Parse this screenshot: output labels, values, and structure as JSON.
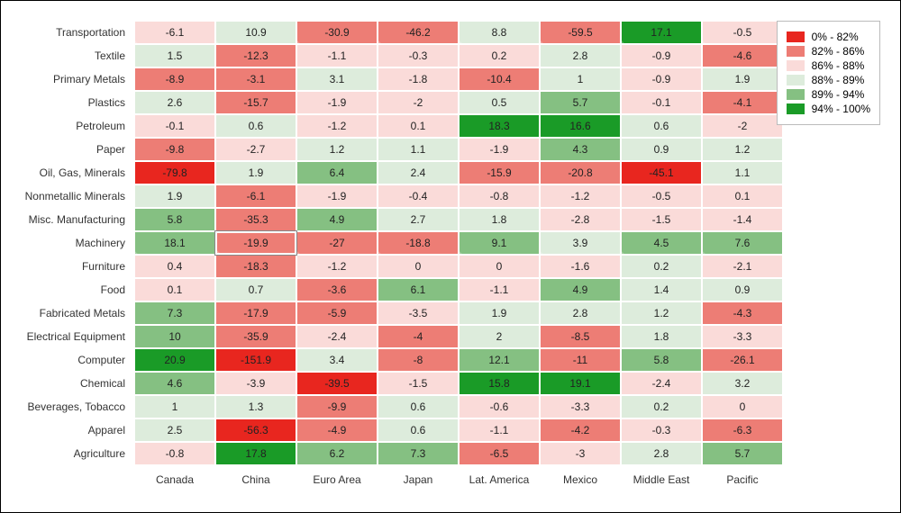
{
  "chart_data": {
    "type": "heatmap",
    "title": "",
    "xlabel": "",
    "ylabel": "",
    "x": [
      "Canada",
      "China",
      "Euro Area",
      "Japan",
      "Lat. America",
      "Mexico",
      "Middle East",
      "Pacific"
    ],
    "y": [
      "Transportation",
      "Textile",
      "Primary Metals",
      "Plastics",
      "Petroleum",
      "Paper",
      "Oil, Gas, Minerals",
      "Nonmetallic Minerals",
      "Misc. Manufacturing",
      "Machinery",
      "Furniture",
      "Food",
      "Fabricated Metals",
      "Electrical Equipment",
      "Computer",
      "Chemical",
      "Beverages, Tobacco",
      "Apparel",
      "Agriculture"
    ],
    "values": [
      [
        -6.1,
        10.9,
        -30.9,
        -46.2,
        8.8,
        -59.5,
        17.1,
        -0.5
      ],
      [
        1.5,
        -12.3,
        -1.1,
        -0.3,
        0.2,
        2.8,
        -0.9,
        -4.6
      ],
      [
        -8.9,
        -3.1,
        3.1,
        -1.8,
        -10.4,
        1,
        -0.9,
        1.9
      ],
      [
        2.6,
        -15.7,
        -1.9,
        -2,
        0.5,
        5.7,
        -0.1,
        -4.1
      ],
      [
        -0.1,
        0.6,
        -1.2,
        0.1,
        18.3,
        16.6,
        0.6,
        -2
      ],
      [
        -9.8,
        -2.7,
        1.2,
        1.1,
        -1.9,
        4.3,
        0.9,
        1.2
      ],
      [
        -79.8,
        1.9,
        6.4,
        2.4,
        -15.9,
        -20.8,
        -45.1,
        1.1
      ],
      [
        1.9,
        -6.1,
        -1.9,
        -0.4,
        -0.8,
        -1.2,
        -0.5,
        0.1
      ],
      [
        5.8,
        -35.3,
        4.9,
        2.7,
        1.8,
        -2.8,
        -1.5,
        -1.4
      ],
      [
        18.1,
        -19.9,
        -27,
        -18.8,
        9.1,
        3.9,
        4.5,
        7.6
      ],
      [
        0.4,
        -18.3,
        -1.2,
        0,
        0,
        -1.6,
        0.2,
        -2.1
      ],
      [
        0.1,
        0.7,
        -3.6,
        6.1,
        -1.1,
        4.9,
        1.4,
        0.9
      ],
      [
        7.3,
        -17.9,
        -5.9,
        -3.5,
        1.9,
        2.8,
        1.2,
        -4.3
      ],
      [
        10,
        -35.9,
        -2.4,
        -4,
        2,
        -8.5,
        1.8,
        -3.3
      ],
      [
        20.9,
        -151.9,
        3.4,
        -8,
        12.1,
        -11,
        5.8,
        -26.1
      ],
      [
        4.6,
        -3.9,
        -39.5,
        -1.5,
        15.8,
        19.1,
        -2.4,
        3.2
      ],
      [
        1,
        1.3,
        -9.9,
        0.6,
        -0.6,
        -3.3,
        0.2,
        0
      ],
      [
        2.5,
        -56.3,
        -4.9,
        0.6,
        -1.1,
        -4.2,
        -0.3,
        -6.3
      ],
      [
        -0.8,
        17.8,
        6.2,
        7.3,
        -6.5,
        -3,
        2.8,
        5.7
      ]
    ],
    "color_bins": [
      [
        2,
        3,
        1,
        1,
        3,
        1,
        5,
        2
      ],
      [
        3,
        1,
        2,
        2,
        2,
        3,
        2,
        1
      ],
      [
        1,
        1,
        3,
        2,
        1,
        3,
        2,
        3
      ],
      [
        3,
        1,
        2,
        2,
        3,
        4,
        2,
        1
      ],
      [
        2,
        3,
        2,
        2,
        5,
        5,
        3,
        2
      ],
      [
        1,
        2,
        3,
        3,
        2,
        4,
        3,
        3
      ],
      [
        0,
        3,
        4,
        3,
        1,
        1,
        0,
        3
      ],
      [
        3,
        1,
        2,
        2,
        2,
        2,
        2,
        2
      ],
      [
        4,
        1,
        4,
        3,
        3,
        2,
        2,
        2
      ],
      [
        4,
        1,
        1,
        1,
        4,
        3,
        4,
        4
      ],
      [
        2,
        1,
        2,
        2,
        2,
        2,
        3,
        2
      ],
      [
        2,
        3,
        1,
        4,
        2,
        4,
        3,
        3
      ],
      [
        4,
        1,
        1,
        2,
        3,
        3,
        3,
        1
      ],
      [
        4,
        1,
        2,
        1,
        3,
        1,
        3,
        2
      ],
      [
        5,
        0,
        3,
        1,
        4,
        1,
        4,
        1
      ],
      [
        4,
        2,
        0,
        2,
        5,
        5,
        2,
        3
      ],
      [
        3,
        3,
        1,
        3,
        2,
        2,
        3,
        2
      ],
      [
        3,
        0,
        1,
        3,
        2,
        1,
        2,
        1
      ],
      [
        2,
        5,
        4,
        4,
        1,
        2,
        3,
        4
      ]
    ],
    "hatched_rows": [
      0,
      9
    ],
    "selected_cell": {
      "row": 9,
      "col": 1
    },
    "legend": [
      {
        "label": "0% - 82%",
        "color_index": 0
      },
      {
        "label": "82% - 86%",
        "color_index": 1
      },
      {
        "label": "86% - 88%",
        "color_index": 2
      },
      {
        "label": "88% - 89%",
        "color_index": 3
      },
      {
        "label": "89% - 94%",
        "color_index": 4
      },
      {
        "label": "94% - 100%",
        "color_index": 5
      }
    ],
    "palette": [
      "#e8261f",
      "#ed7d75",
      "#fadbd9",
      "#ddecdc",
      "#85c082",
      "#1a9b27"
    ]
  }
}
